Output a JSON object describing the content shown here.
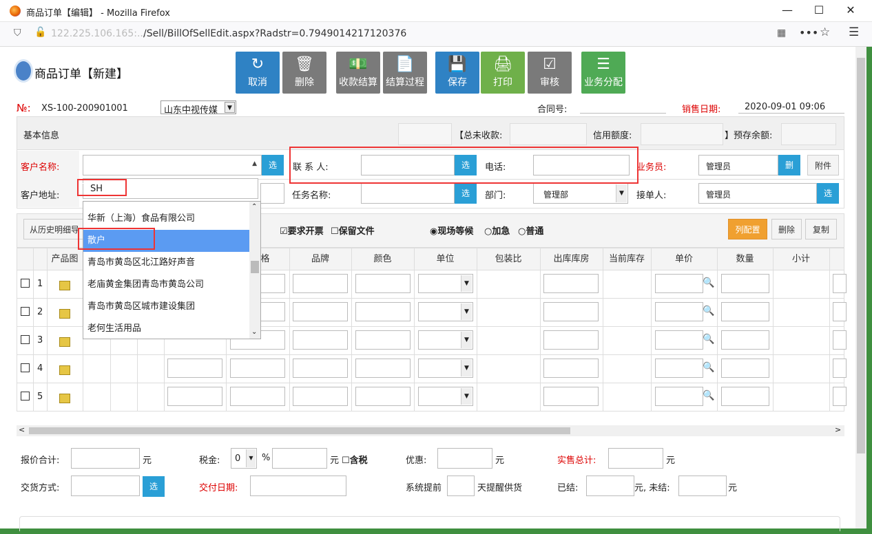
{
  "window": {
    "title": "商品订单【编辑】 - Mozilla Firefox",
    "url_host": "122.225.106.165:...",
    "url_path": "/Sell/BillOfSellEdit.aspx?Radstr=0.7949014217120376"
  },
  "page": {
    "title": "商品订单【新建】"
  },
  "toolbar": [
    {
      "icon": "undo-icon",
      "glyph": "↻",
      "label": "取消"
    },
    {
      "icon": "trash-icon",
      "glyph": "🗑",
      "label": "删除"
    },
    {
      "icon": "money-icon",
      "glyph": "💵",
      "label": "收款结算"
    },
    {
      "icon": "document-icon",
      "glyph": "📄",
      "label": "结算过程"
    },
    {
      "icon": "save-icon",
      "glyph": "💾",
      "label": "保存"
    },
    {
      "icon": "print-icon",
      "glyph": "🖨",
      "label": "打印"
    },
    {
      "icon": "check-icon",
      "glyph": "☑",
      "label": "审核"
    },
    {
      "icon": "list-icon",
      "glyph": "☰",
      "label": "业务分配"
    }
  ],
  "header": {
    "no_label": "№:",
    "no_value": "XS-100-200901001",
    "company": "山东中视传媒",
    "contract_label": "合同号:",
    "sale_date_label": "销售日期:",
    "sale_date_value": "2020-09-01 09:06"
  },
  "basic": {
    "label": "基本信息",
    "unreceived_label": "【总未收款:",
    "credit_label": "信用额度:",
    "prepay_label": "】预存余额:"
  },
  "form": {
    "customer_label": "客户名称:",
    "customer_search": "SH",
    "select_label": "选",
    "contact_label": "联 系 人:",
    "phone_label": "电话:",
    "salesman_label": "业务员:",
    "salesman_value": "管理员",
    "delete_label": "删",
    "attach_label": "附件",
    "address_label": "客户地址:",
    "task_label": "任务名称:",
    "dept_label": "部门:",
    "dept_value": "管理部",
    "receiver_label": "接单人:",
    "receiver_value": "管理员"
  },
  "dropdown": {
    "items": [
      "华新（上海）食品有限公司",
      "散户",
      "青岛市黄岛区北江路好声音",
      "老庙黄金集团青岛市黄岛公司",
      "青岛市黄岛区城市建设集团",
      "老何生活用品"
    ],
    "selected_index": 1
  },
  "options": {
    "history": "从历史明细导",
    "invoice": "要求开票",
    "keep_file": "保留文件",
    "r1": "现场等候",
    "r2": "加急",
    "r3": "普通",
    "col_config": "列配置",
    "delete": "删除",
    "copy": "复制"
  },
  "table": {
    "headers": [
      "产品图",
      "品牌",
      "颜色",
      "单位",
      "包装比",
      "出库库房",
      "当前库存",
      "单价",
      "数量",
      "小计"
    ],
    "partial_header": "格",
    "rows": [
      "1",
      "2",
      "3",
      "4",
      "5"
    ]
  },
  "footer": {
    "quote_total": "报价合计:",
    "yuan": "元",
    "tax_label": "税金:",
    "tax_value": "0",
    "percent": "%",
    "tax_incl": "含税",
    "discount": "优惠:",
    "actual_total": "实售总计:",
    "delivery_label": "交货方式:",
    "select": "选",
    "pay_date": "交付日期:",
    "remind_pre": "系统提前",
    "remind_post": "天提醒供货",
    "settled": "已结:",
    "unsettled": "元, 未结:"
  }
}
